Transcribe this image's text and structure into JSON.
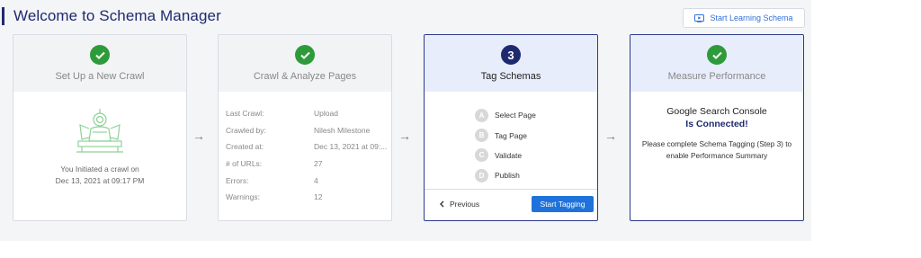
{
  "header": {
    "title": "Welcome to Schema Manager",
    "learn_button": "Start Learning Schema",
    "learn_icon": "play-screen-icon"
  },
  "colors": {
    "brand": "#1f2a6e",
    "success": "#2e9b3a",
    "primary_button": "#1f72d9"
  },
  "steps": [
    {
      "title": "Set Up a New Crawl",
      "status": "complete",
      "icon": "crawler-robot-icon",
      "text_line1": "You Initiated a crawl on",
      "text_line2": "Dec 13, 2021 at 09:17 PM"
    },
    {
      "title": "Crawl & Analyze Pages",
      "status": "complete",
      "details": [
        {
          "label": "Last Crawl:",
          "value": "Upload"
        },
        {
          "label": "Crawled by:",
          "value": "Nilesh Milestone"
        },
        {
          "label": "Created at:",
          "value": "Dec 13, 2021 at 09:..."
        },
        {
          "label": "# of URLs:",
          "value": "27"
        },
        {
          "label": "Errors:",
          "value": "4"
        },
        {
          "label": "Warnings:",
          "value": "12"
        }
      ]
    },
    {
      "title": "Tag Schemas",
      "number": "3",
      "status": "active",
      "substeps": [
        {
          "letter": "A",
          "label": "Select Page"
        },
        {
          "letter": "B",
          "label": "Tag Page"
        },
        {
          "letter": "C",
          "label": "Validate"
        },
        {
          "letter": "D",
          "label": "Publish"
        }
      ],
      "previous_label": "Previous",
      "start_label": "Start Tagging"
    },
    {
      "title": "Measure Performance",
      "status": "complete",
      "gsc_title": "Google Search Console",
      "gsc_status": "Is Connected!",
      "note_line1": "Please complete Schema Tagging (Step 3) to",
      "note_line2": "enable Performance Summary"
    }
  ],
  "arrow_glyph": "→"
}
